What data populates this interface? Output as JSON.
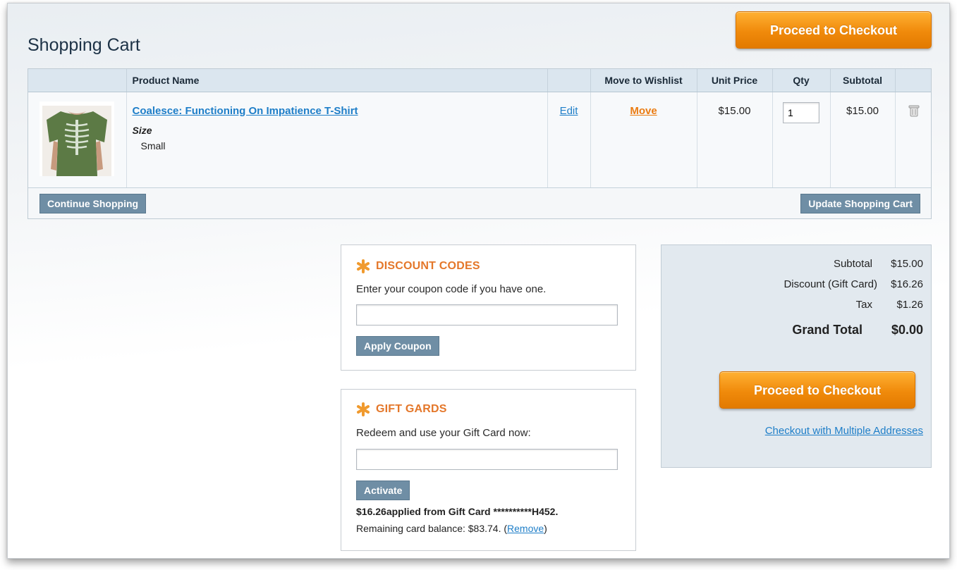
{
  "header": {
    "title": "Shopping Cart",
    "checkout_label": "Proceed to Checkout"
  },
  "cart": {
    "columns": {
      "product_name": "Product Name",
      "move_to_wishlist": "Move to Wishlist",
      "unit_price": "Unit Price",
      "qty": "Qty",
      "subtotal": "Subtotal"
    },
    "items": [
      {
        "name": "Coalesce: Functioning On Impatience T-Shirt",
        "option_label": "Size",
        "option_value": "Small",
        "edit_label": "Edit",
        "move_label": "Move",
        "unit_price": "$15.00",
        "qty": "1",
        "subtotal": "$15.00",
        "image_icon": "green-tshirt-product-image",
        "remove_icon": "trash-icon"
      }
    ],
    "continue_label": "Continue Shopping",
    "update_label": "Update Shopping Cart"
  },
  "discount": {
    "title": "DISCOUNT CODES",
    "description": "Enter your coupon code if you have one.",
    "value": "",
    "button": "Apply Coupon",
    "icon": "asterisk-icon"
  },
  "giftcard": {
    "title": "GIFT GARDS",
    "description": "Redeem and use your Gift Card now:",
    "value": "",
    "button": "Activate",
    "applied": "$16.26applied from Gift Card **********H452.",
    "remaining_prefix": "Remaining card balance: $83.74. (",
    "remove_label": "Remove",
    "remaining_suffix": ")",
    "icon": "asterisk-icon"
  },
  "totals": {
    "subtotal_label": "Subtotal",
    "subtotal": "$15.00",
    "discount_label": "Discount (Gift Card)",
    "discount": "$16.26",
    "tax_label": "Tax",
    "tax": "$1.26",
    "grand_total_label": "Grand Total",
    "grand_total": "$0.00",
    "checkout_label": "Proceed to Checkout",
    "multi_address_label": "Checkout with Multiple Addresses"
  },
  "colors": {
    "accent_orange": "#f08a0b",
    "link_blue": "#1e7ec8",
    "button_grey_blue": "#6f8ea5",
    "heading_orange": "#e4772a"
  }
}
